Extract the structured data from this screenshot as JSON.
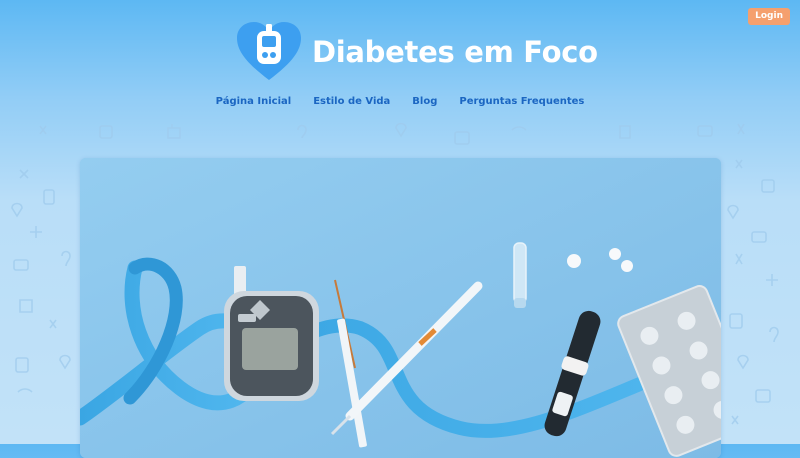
{
  "header": {
    "login_label": "Login",
    "brand_name": "Diabetes em Foco",
    "logo_icon": "heart-glucometer-icon",
    "nav": [
      {
        "label": "Página Inicial"
      },
      {
        "label": "Estilo de Vida"
      },
      {
        "label": "Blog"
      },
      {
        "label": "Perguntas Frequentes"
      }
    ]
  },
  "hero": {
    "image": "blue-ribbon-glucometer-syringes-insulin-pen-pills"
  },
  "colors": {
    "login_button": "#f5a06e",
    "nav_link": "#1b66c2",
    "logo_heart": "#3d9ff0",
    "background_top": "#5db8f3",
    "background_bottom": "#c2e2f8"
  }
}
